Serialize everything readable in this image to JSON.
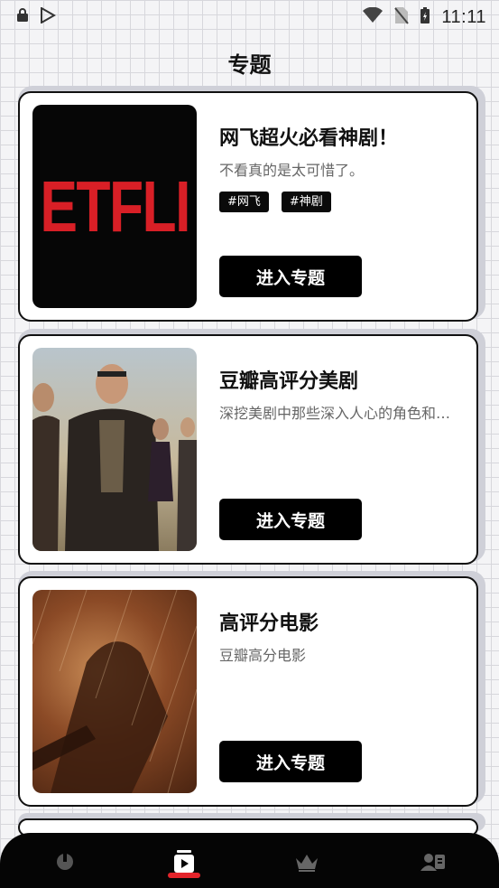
{
  "status_bar": {
    "time": "11:11",
    "icons_left": [
      "lock-icon",
      "play-store-icon"
    ],
    "icons_right": [
      "wifi-icon",
      "no-sim-icon",
      "battery-charging-icon"
    ]
  },
  "header": {
    "title": "专题"
  },
  "cards": [
    {
      "title": "网飞超火必看神剧！",
      "description": "不看真的是太可惜了。",
      "tags": [
        "#网飞",
        "#神剧"
      ],
      "thumbnail_text": "ETFLI",
      "button_label": "进入专题"
    },
    {
      "title": "豆瓣高评分美剧",
      "description": "深挖美剧中那些深入人心的角色和故事",
      "tags": [],
      "button_label": "进入专题"
    },
    {
      "title": "高评分电影",
      "description": "豆瓣高分电影",
      "tags": [],
      "button_label": "进入专题"
    }
  ],
  "bottom_nav": {
    "items": [
      "home-icon",
      "video-icon",
      "crown-icon",
      "profile-card-icon"
    ],
    "active": "video-icon"
  },
  "colors": {
    "accent": "#e3242b",
    "netflix_red": "#d81f26",
    "nav_bg": "#050505"
  }
}
